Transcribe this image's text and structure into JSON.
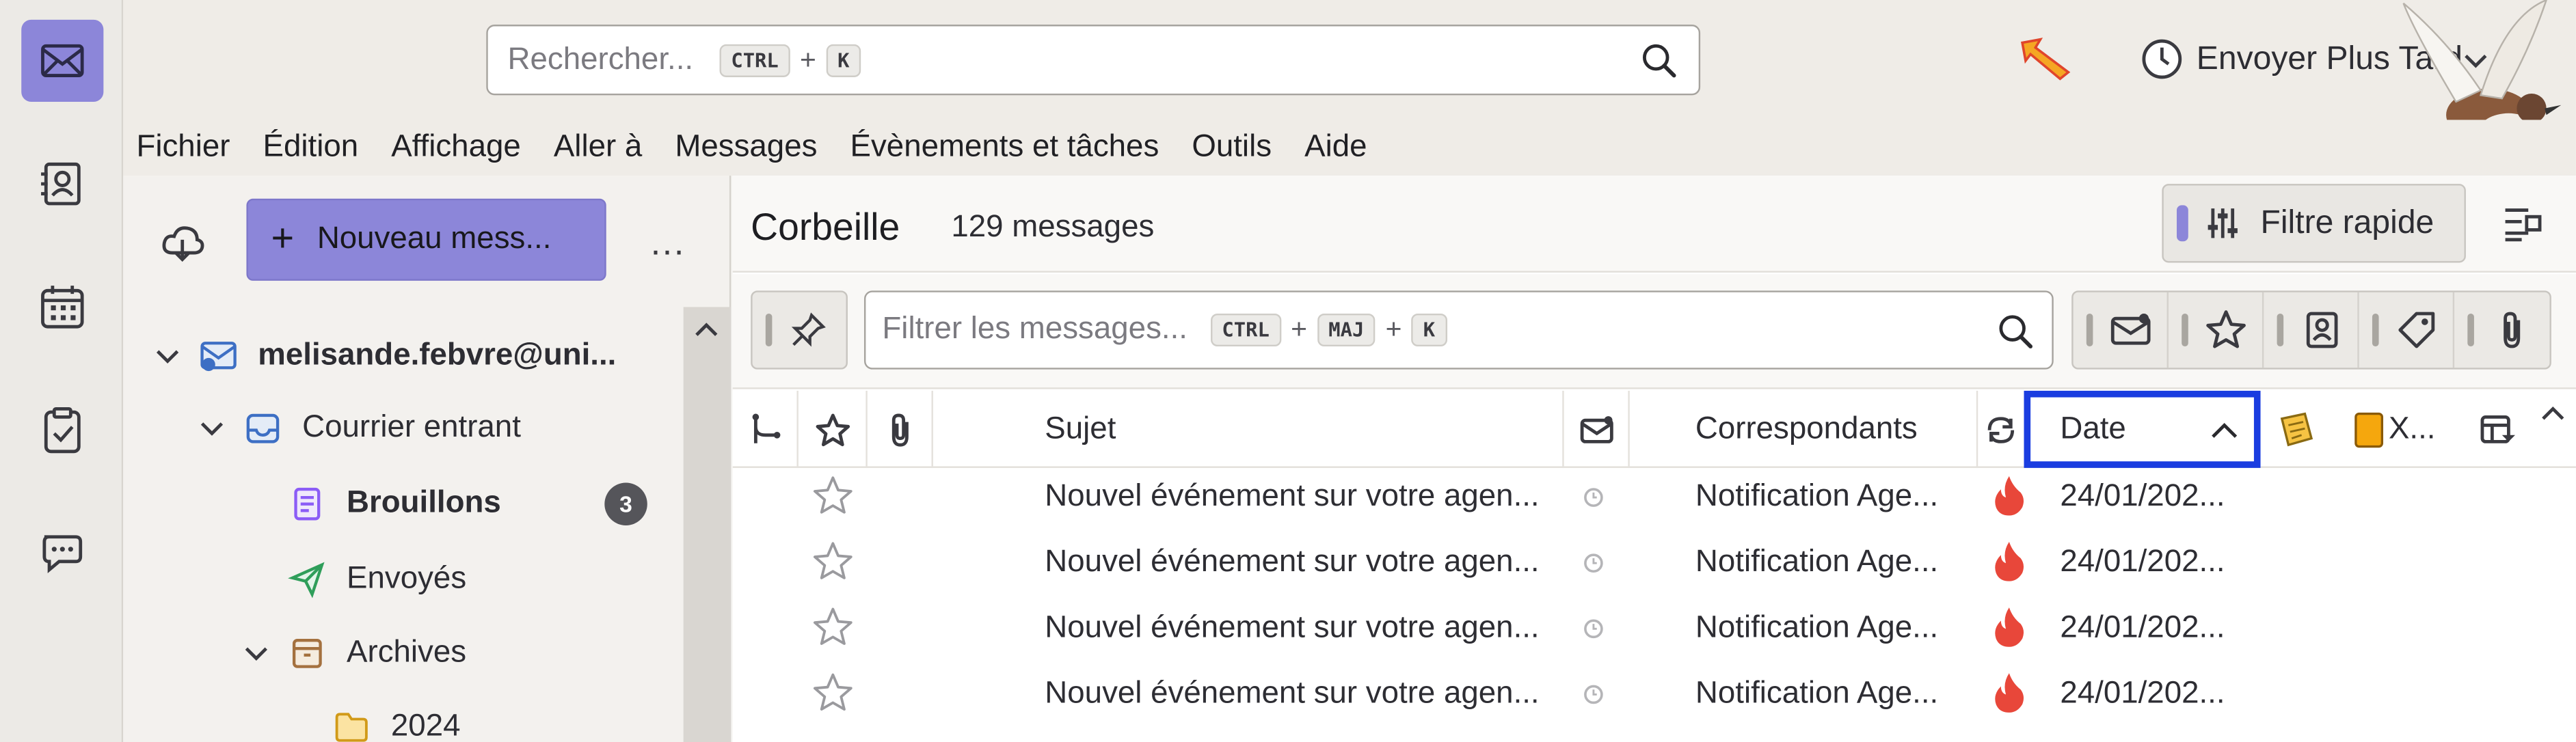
{
  "colors": {
    "accent": "#8c86d9",
    "date_focus_border": "#1a3de0",
    "flame": "#e8473a"
  },
  "spaces": [
    {
      "name": "mail",
      "icon": "mail-icon",
      "active": true
    },
    {
      "name": "address-book",
      "icon": "address-book-icon"
    },
    {
      "name": "calendar",
      "icon": "calendar-icon"
    },
    {
      "name": "tasks",
      "icon": "tasks-icon"
    },
    {
      "name": "chat",
      "icon": "chat-icon"
    }
  ],
  "search": {
    "placeholder": "Rechercher...",
    "shortcut_key1": "CTRL",
    "shortcut_plus": "+",
    "shortcut_key2": "K"
  },
  "send_later": {
    "label": "Envoyer Plus Tard"
  },
  "menubar": [
    "Fichier",
    "Édition",
    "Affichage",
    "Aller à",
    "Messages",
    "Évènements et tâches",
    "Outils",
    "Aide"
  ],
  "folder_pane": {
    "new_message_label": "Nouveau mess...",
    "more_label": "...",
    "account": "melisande.febvre@uni...",
    "inbox": "Courrier entrant",
    "drafts": "Brouillons",
    "drafts_count": "3",
    "sent": "Envoyés",
    "archives": "Archives",
    "year_folder": "2024"
  },
  "thread_pane": {
    "folder_name": "Corbeille",
    "message_count": "129 messages",
    "quick_filter_label": "Filtre rapide",
    "filter_placeholder": "Filtrer les messages...",
    "filter_key1": "CTRL",
    "filter_key2": "MAJ",
    "filter_key3": "K",
    "filter_plus": "+",
    "columns": {
      "subject": "Sujet",
      "correspondents": "Correspondants",
      "date": "Date",
      "extra": "X..."
    },
    "rows": [
      {
        "subject": "Nouvel événement sur votre agen...",
        "correspondent": "Notification Age...",
        "date": "24/01/202..."
      },
      {
        "subject": "Nouvel événement sur votre agen...",
        "correspondent": "Notification Age...",
        "date": "24/01/202..."
      },
      {
        "subject": "Nouvel événement sur votre agen...",
        "correspondent": "Notification Age...",
        "date": "24/01/202..."
      },
      {
        "subject": "Nouvel événement sur votre agen...",
        "correspondent": "Notification Age...",
        "date": "24/01/202..."
      }
    ]
  }
}
